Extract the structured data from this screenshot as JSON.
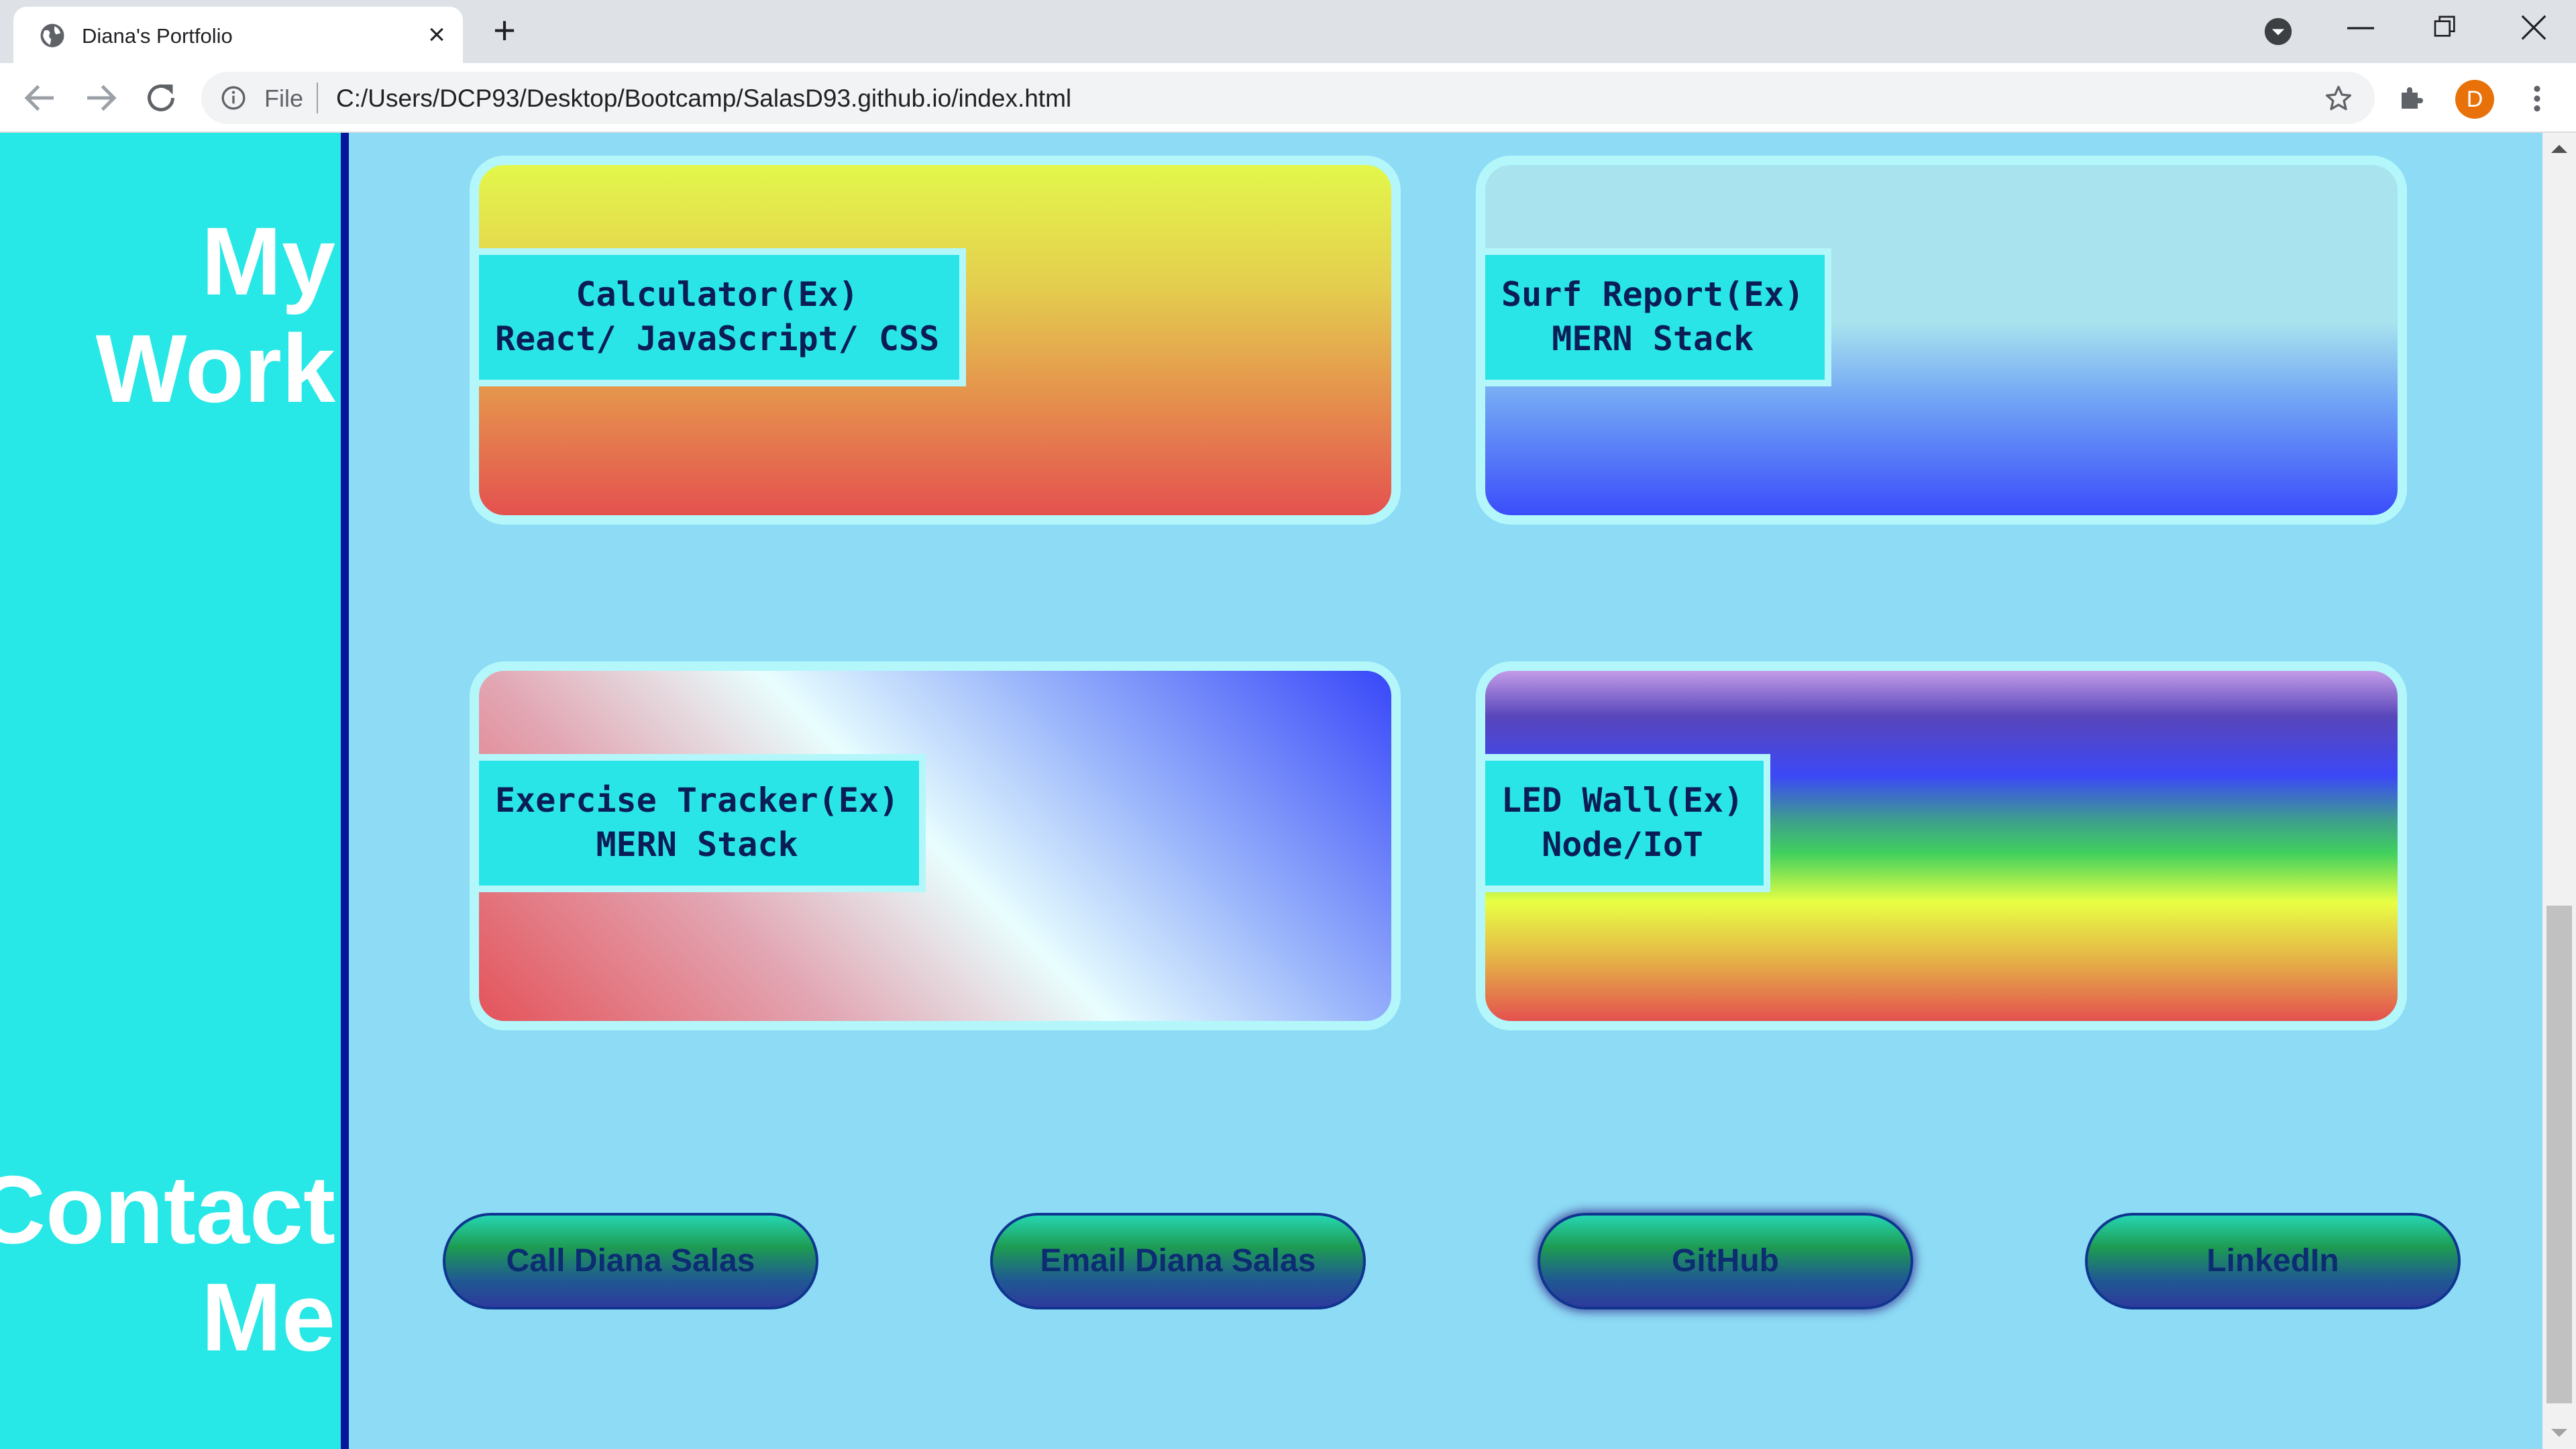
{
  "browser": {
    "tab_title": "Diana's Portfolio",
    "tab_close": "×",
    "new_tab": "+",
    "url_scheme_label": "File",
    "url": "C:/Users/DCP93/Desktop/Bootcamp/SalasD93.github.io/index.html",
    "profile_initial": "D",
    "profile_color": "#e8710a"
  },
  "sidebar": {
    "work_heading_line1": "My",
    "work_heading_line2": "Work",
    "contact_heading_line1": "Contact",
    "contact_heading_line2": "Me"
  },
  "projects": [
    {
      "title": "Calculator(Ex)",
      "stack": "React/ JavaScript/ CSS"
    },
    {
      "title": "Surf Report(Ex)",
      "stack": "MERN Stack"
    },
    {
      "title": "Exercise Tracker(Ex)",
      "stack": "MERN Stack"
    },
    {
      "title": "LED Wall(Ex)",
      "stack": "Node/IoT"
    }
  ],
  "contact_buttons": [
    {
      "label": "Call Diana Salas"
    },
    {
      "label": "Email Diana Salas"
    },
    {
      "label": "GitHub"
    },
    {
      "label": "LinkedIn"
    }
  ],
  "colors": {
    "page_background": "#8ddbf5",
    "sidebar_background": "#28e7e7",
    "sidebar_border": "#08179a",
    "label_background": "#2ae5e7",
    "card_border": "#b3f7fb",
    "label_text": "#0b1d55"
  },
  "icons": [
    "globe-icon",
    "close-icon",
    "plus-icon",
    "tab-search-icon",
    "minimize-icon",
    "restore-icon",
    "window-close-icon",
    "back-arrow-icon",
    "forward-arrow-icon",
    "reload-icon",
    "info-icon",
    "star-icon",
    "puzzle-extensions-icon",
    "more-vert-icon"
  ]
}
